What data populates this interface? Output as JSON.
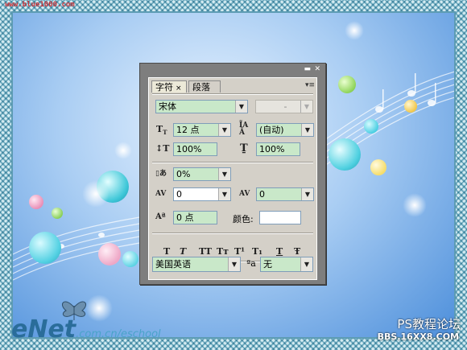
{
  "watermark": {
    "top_url": "www.blue1000.com",
    "brand_e": "eNet",
    "brand_site": ".com.cn/eschool",
    "forum_title": "PS教程论坛",
    "forum_url": "BBS.16XX8.COM"
  },
  "panel": {
    "tabs": [
      {
        "label": "字符"
      },
      {
        "label": "段落"
      }
    ],
    "tab_close_glyph": "×",
    "menu_glyph": "▾≡",
    "font_family": "宋体",
    "font_style": "-",
    "font_size": "12 点",
    "leading": "(自动)",
    "vertical_scale": "100%",
    "horizontal_scale": "100%",
    "tsume": "0%",
    "kerning": "0",
    "tracking": "0",
    "baseline_shift": "0 点",
    "color_label": "颜色:",
    "style_buttons": [
      "T",
      "T",
      "TT",
      "Tт",
      "T¹",
      "T₁",
      "T",
      "Ŧ"
    ],
    "language": "美国英语",
    "aa_label": "ªa",
    "anti_alias": "无"
  },
  "colors": {
    "field_bg": "#c9e8c9",
    "panel_bg": "#d4d0c8",
    "frame": "#5d9cb3"
  }
}
